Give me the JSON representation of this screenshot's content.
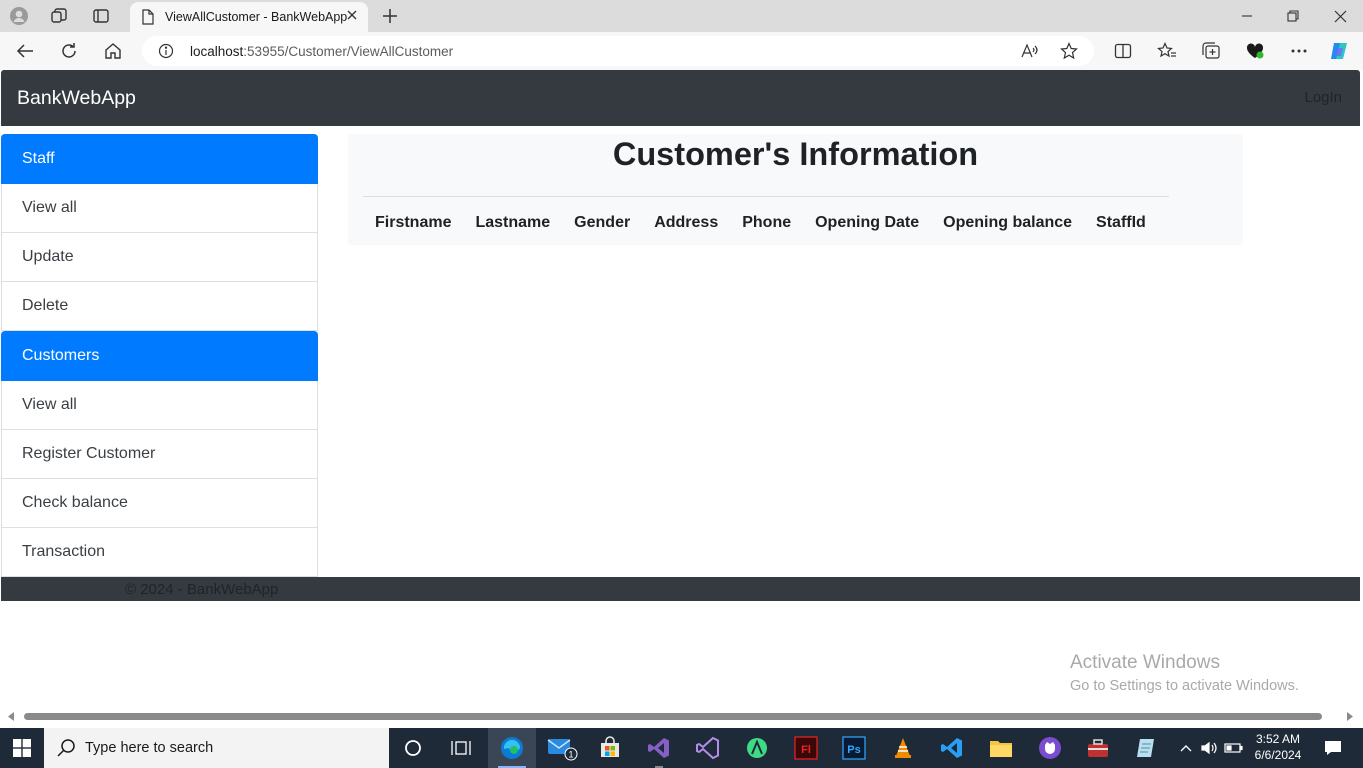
{
  "browser": {
    "tab_title": "ViewAllCustomer - BankWebApp",
    "url_host": "localhost",
    "url_rest": ":53955/Customer/ViewAllCustomer"
  },
  "app": {
    "brand": "BankWebApp",
    "login_label": "LogIn",
    "accent_color": "#007bff",
    "navbar_color": "#343a40"
  },
  "sidebar": {
    "items": [
      {
        "label": "Staff",
        "active": true
      },
      {
        "label": "View all",
        "active": false
      },
      {
        "label": "Update",
        "active": false
      },
      {
        "label": "Delete",
        "active": false
      },
      {
        "label": "Customers",
        "active": true
      },
      {
        "label": "View all",
        "active": false
      },
      {
        "label": "Register Customer",
        "active": false
      },
      {
        "label": "Check balance",
        "active": false
      },
      {
        "label": "Transaction",
        "active": false
      }
    ]
  },
  "main": {
    "heading": "Customer's Information",
    "columns": [
      "Firstname",
      "Lastname",
      "Gender",
      "Address",
      "Phone",
      "Opening Date",
      "Opening balance",
      "StaffId"
    ]
  },
  "footer": {
    "text": "© 2024 - BankWebApp"
  },
  "watermark": {
    "line1": "Activate Windows",
    "line2": "Go to Settings to activate Windows."
  },
  "taskbar": {
    "search_placeholder": "Type here to search",
    "mail_badge": "1",
    "time": "3:52 AM",
    "date": "6/6/2024"
  }
}
